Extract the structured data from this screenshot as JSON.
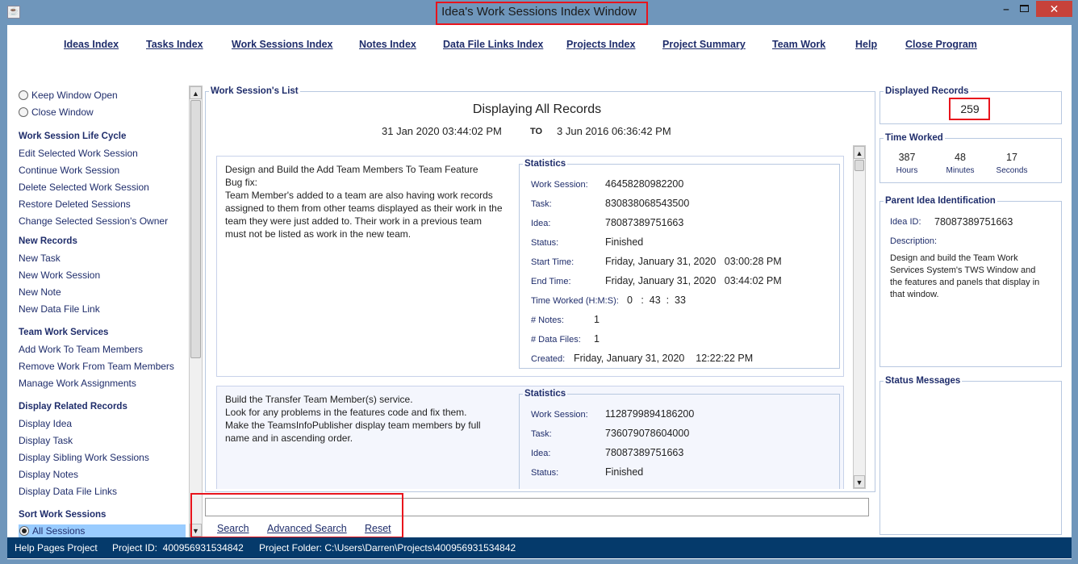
{
  "window": {
    "title": "Idea's Work Sessions Index Window",
    "icon": "java-icon",
    "controls": [
      "minimize",
      "maximize",
      "close"
    ]
  },
  "menu": [
    "Ideas Index",
    "Tasks Index",
    "Work Sessions Index",
    "Notes Index",
    "Data File Links Index",
    "Projects Index",
    "Project Summary",
    "Team Work",
    "Help",
    "Close Program"
  ],
  "sidebar": {
    "window_options": [
      "Keep Window Open",
      "Close Window"
    ],
    "sections": [
      {
        "title": "Work Session Life Cycle",
        "items": [
          "Edit Selected Work Session",
          "Continue Work Session",
          "Delete Selected Work Session",
          "Restore Deleted Sessions",
          "Change Selected Session's Owner"
        ]
      },
      {
        "title": "New Records",
        "items": [
          "New Task",
          "New Work Session",
          "New Note",
          "New Data File Link"
        ]
      },
      {
        "title": "Team Work Services",
        "items": [
          "Add Work To Team Members",
          "Remove Work From Team Members",
          "Manage Work Assignments"
        ]
      },
      {
        "title": "Display Related Records",
        "items": [
          "Display Idea",
          "Display Task",
          "Display Sibling Work Sessions",
          "Display Notes",
          "Display Data File Links"
        ]
      },
      {
        "title": "Sort Work Sessions",
        "items": [
          "All Sessions"
        ]
      }
    ],
    "selected_sort": "All Sessions"
  },
  "list": {
    "title": "Work Session's List",
    "heading": "Displaying All Records",
    "range_start": "31 Jan 2020   03:44:02 PM",
    "range_to": "TO",
    "range_end": "3 Jun 2016   06:36:42 PM",
    "records": [
      {
        "description": "Design and Build the Add Team Members To Team Feature\nBug fix:\nTeam Member's added to a team are also having work records assigned to them from other teams displayed as their work in the team they were just added to. Their work in a previous team must not be listed as work in the new team.",
        "stats_title": "Statistics",
        "work_session_label": "Work Session:",
        "work_session": "46458280982200",
        "task_label": "Task:",
        "task": "830838068543500",
        "idea_label": "Idea:",
        "idea": "78087389751663",
        "status_label": "Status:",
        "status": "Finished",
        "start_label": "Start Time:",
        "start": "Friday, January 31, 2020   03:00:28 PM",
        "end_label": "End Time:",
        "end": "Friday, January 31, 2020   03:44:02 PM",
        "worked_label": "Time Worked (H:M:S):",
        "worked": "0   :  43  :  33",
        "notes_label": "# Notes:",
        "notes": "1",
        "files_label": "# Data Files:",
        "files": "1",
        "created_label": "Created:",
        "created": "Friday, January 31, 2020    12:22:22 PM"
      },
      {
        "description": "Build the Transfer Team Member(s) service.\nLook for any problems in the features code and fix them.\nMake the TeamsInfoPublisher display team members by full name and in ascending order.",
        "stats_title": "Statistics",
        "work_session_label": "Work Session:",
        "work_session": "1128799894186200",
        "task_label": "Task:",
        "task": "736079078604000",
        "idea_label": "Idea:",
        "idea": "78087389751663",
        "status_label": "Status:",
        "status": "Finished"
      }
    ]
  },
  "search": {
    "value": "",
    "search": "Search",
    "advanced": "Advanced Search",
    "reset": "Reset"
  },
  "right": {
    "displayed_title": "Displayed Records",
    "displayed_count": "259",
    "time_title": "Time Worked",
    "hours": "387",
    "hours_label": "Hours",
    "minutes": "48",
    "minutes_label": "Minutes",
    "seconds": "17",
    "seconds_label": "Seconds",
    "parent_title": "Parent Idea Identification",
    "idea_id_label": "Idea ID:",
    "idea_id": "78087389751663",
    "desc_label": "Description:",
    "desc": "Design and build the Team Work Services System's TWS Window and the features and panels that display in that window.",
    "status_title": "Status Messages"
  },
  "statusbar": {
    "project": "Help Pages Project",
    "project_id": "Project ID:  400956931534842",
    "folder": "Project Folder: C:\\Users\\Darren\\Projects\\400956931534842"
  },
  "colors": {
    "titlebar": "#6f96bb",
    "statusbar": "#053a6b",
    "label": "#1f2d6b",
    "highlight": "#99ccff",
    "annotation": "#e8141c"
  }
}
